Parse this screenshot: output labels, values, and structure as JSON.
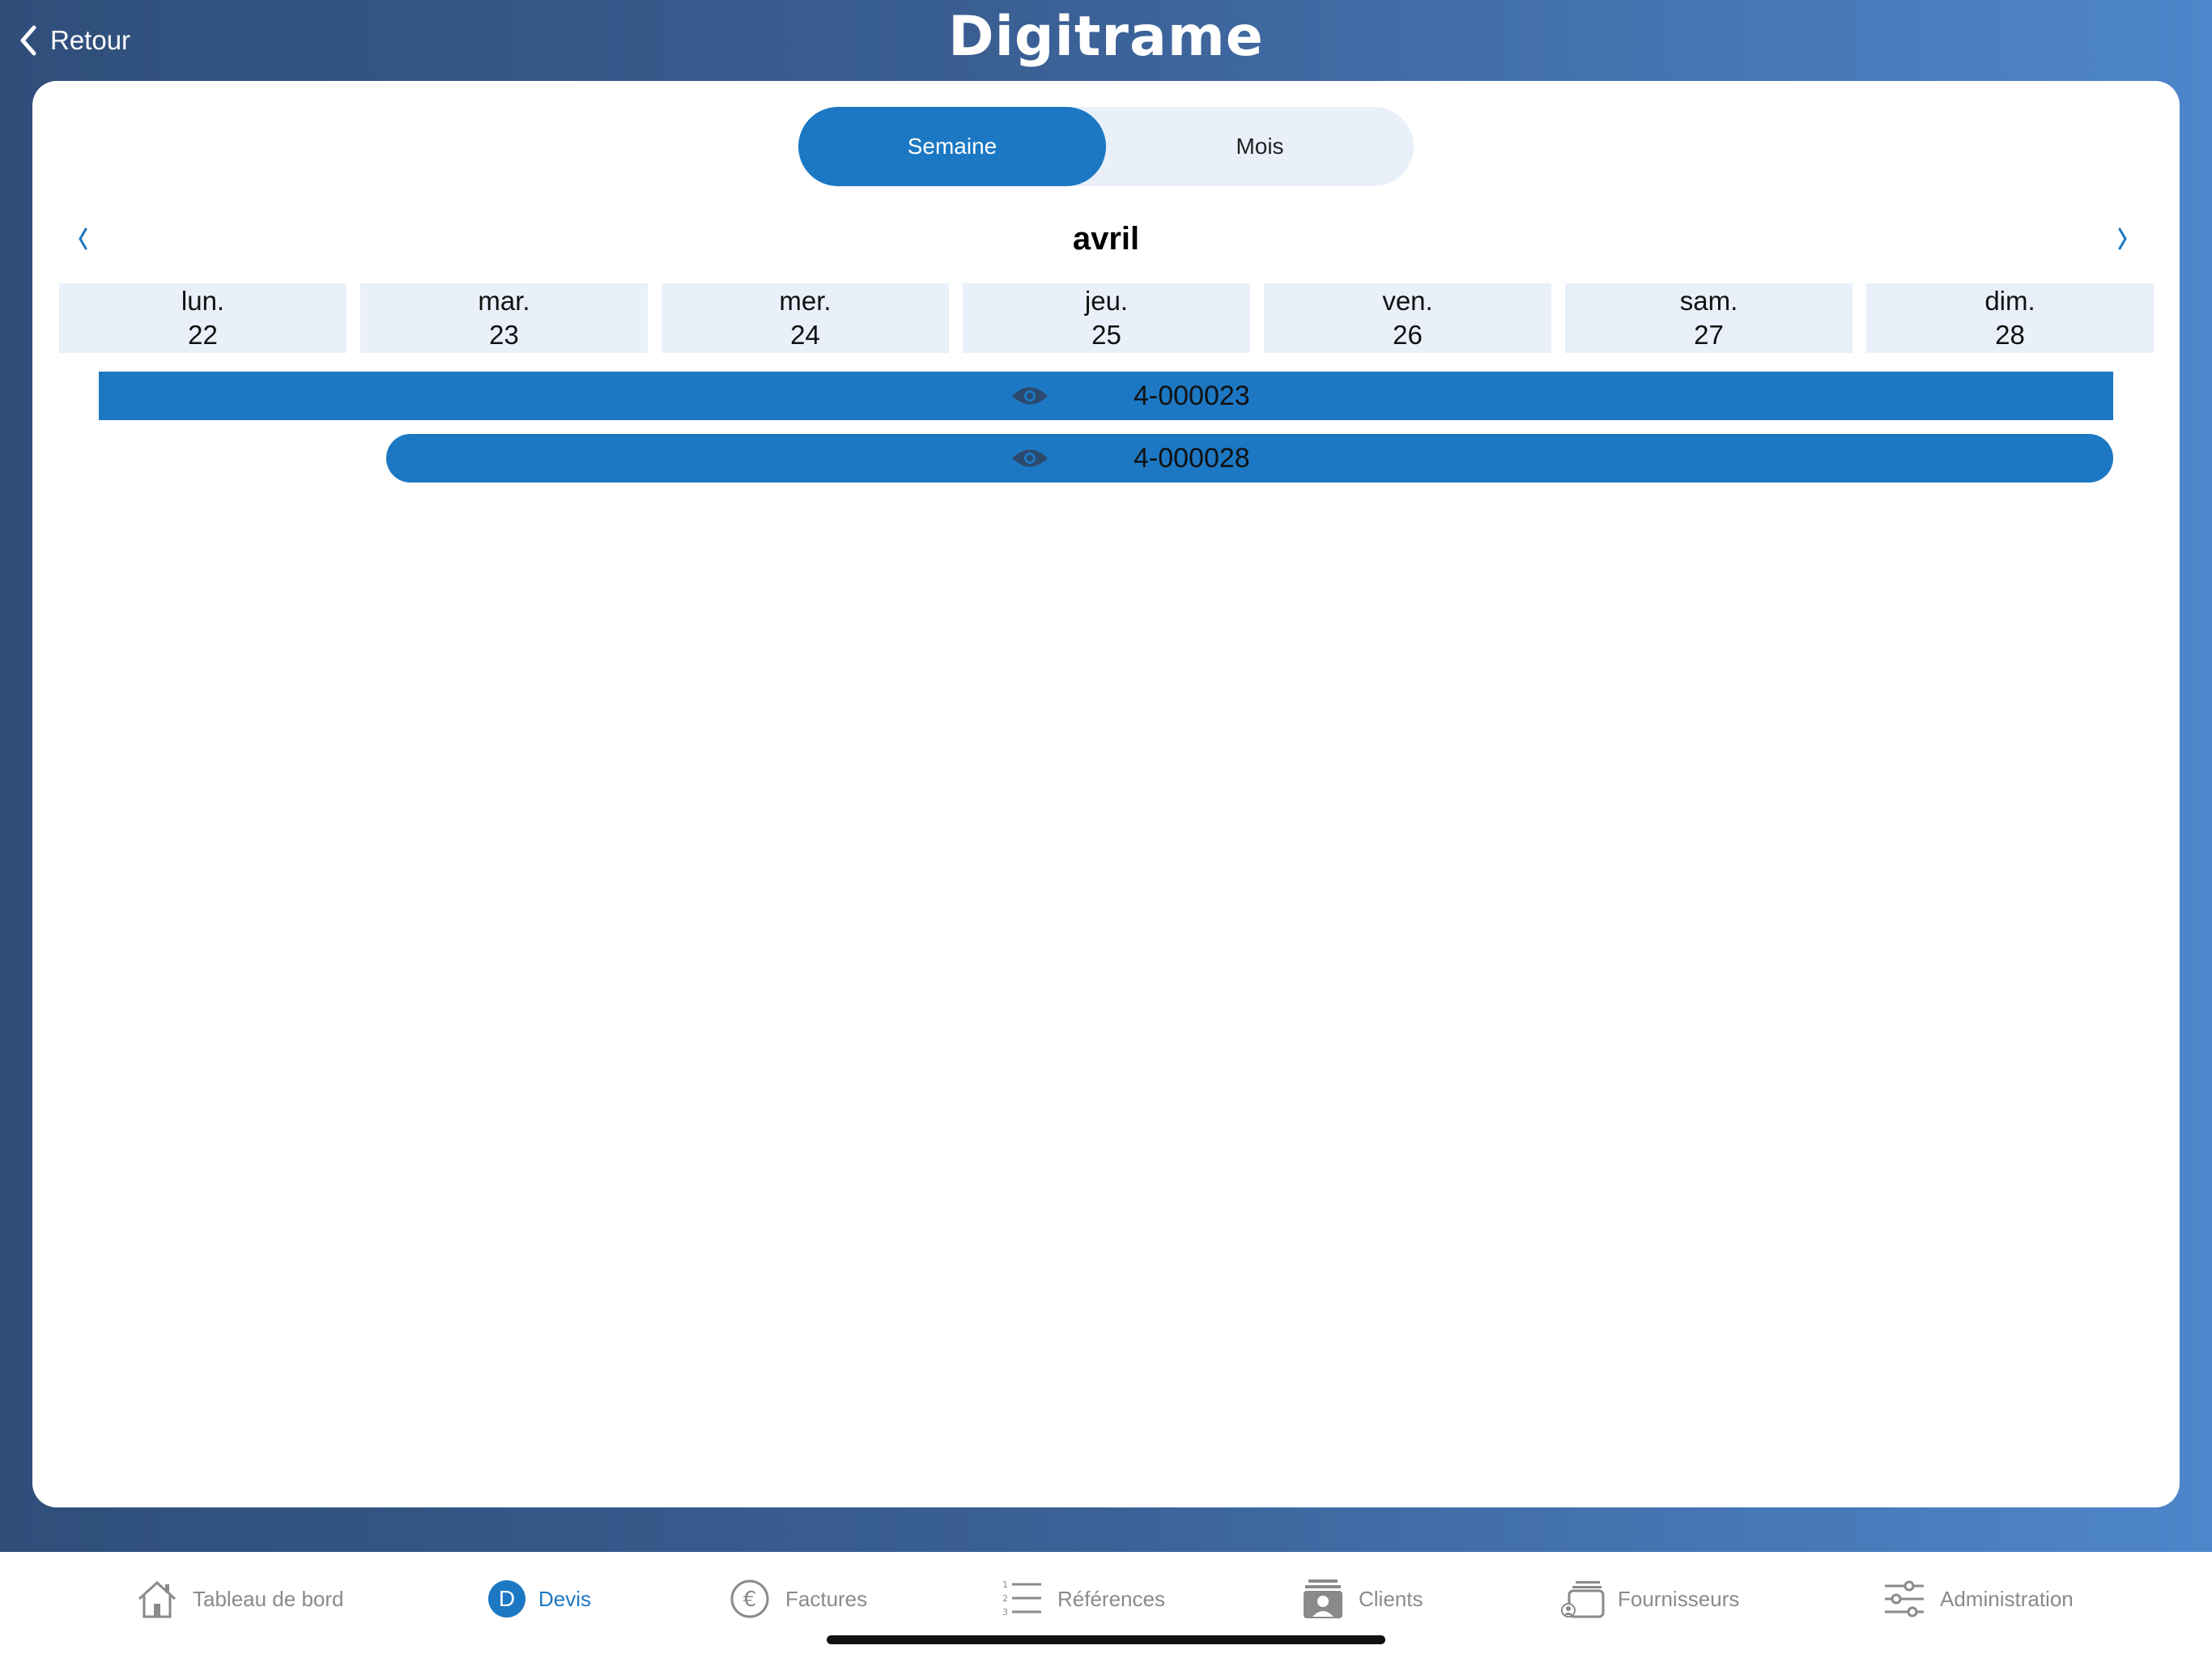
{
  "header": {
    "back_label": "Retour",
    "logo": "Digitrame"
  },
  "view_toggle": {
    "options": [
      "Semaine",
      "Mois"
    ],
    "selected": "Semaine"
  },
  "calendar": {
    "month": "avril",
    "prev_icon": "chevron-left-icon",
    "next_icon": "chevron-right-icon",
    "days": [
      {
        "name": "lun.",
        "num": "22"
      },
      {
        "name": "mar.",
        "num": "23"
      },
      {
        "name": "mer.",
        "num": "24"
      },
      {
        "name": "jeu.",
        "num": "25"
      },
      {
        "name": "ven.",
        "num": "26"
      },
      {
        "name": "sam.",
        "num": "27"
      },
      {
        "name": "dim.",
        "num": "28"
      }
    ],
    "events": [
      {
        "label": "4-000023",
        "icon": "eye-icon"
      },
      {
        "label": "4-000028",
        "icon": "eye-icon"
      }
    ]
  },
  "tabbar": {
    "items": [
      {
        "label": "Tableau de bord",
        "icon": "home-icon"
      },
      {
        "label": "Devis",
        "icon": "devis-icon",
        "badge": "D"
      },
      {
        "label": "Factures",
        "icon": "euro-icon"
      },
      {
        "label": "Références",
        "icon": "numbered-list-icon"
      },
      {
        "label": "Clients",
        "icon": "contact-card-icon"
      },
      {
        "label": "Fournisseurs",
        "icon": "supplier-icon"
      },
      {
        "label": "Administration",
        "icon": "sliders-icon"
      }
    ],
    "active": "Devis"
  },
  "colors": {
    "accent": "#1c78c3",
    "day_header_bg": "#e9f0fa",
    "inactive_tab": "#8a8a8a"
  }
}
